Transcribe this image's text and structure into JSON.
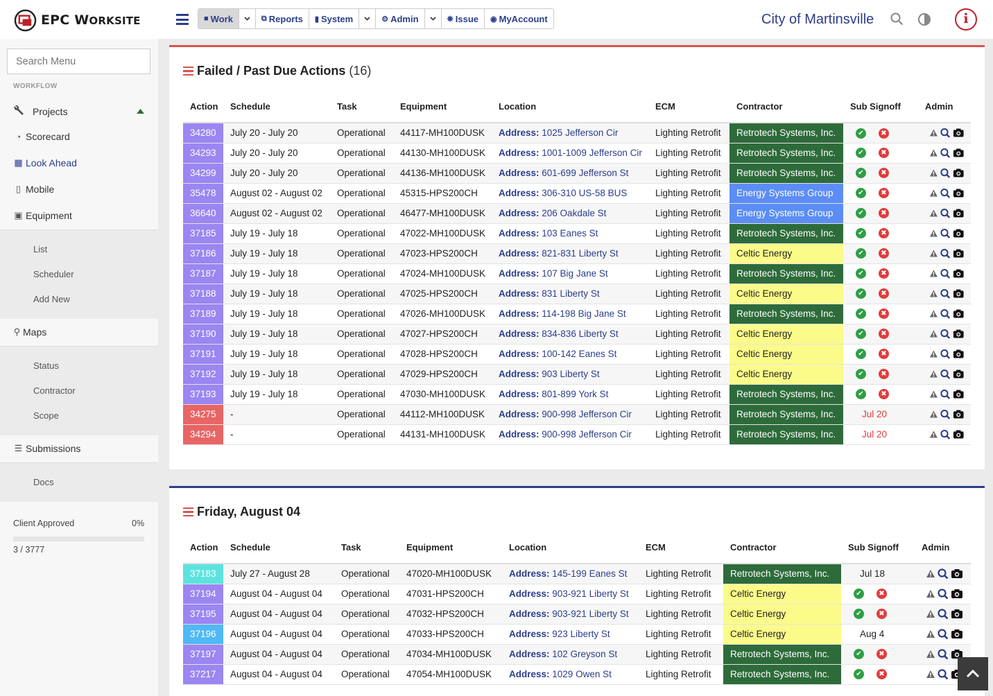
{
  "brand": {
    "logo_text": "EPC W",
    "logo_text_small": "ORKSITE"
  },
  "nav": [
    {
      "label": "Work",
      "icon": "folder-icon",
      "caret": true,
      "active": true
    },
    {
      "label": "Reports",
      "icon": "copy-icon",
      "caret": false
    },
    {
      "label": "System",
      "icon": "lock-icon",
      "caret": true
    },
    {
      "label": "Admin",
      "icon": "cogs-icon",
      "caret": true
    },
    {
      "label": "Issue",
      "icon": "bug-icon",
      "caret": false
    },
    {
      "label": "MyAccount",
      "icon": "user-circle-icon",
      "caret": false
    }
  ],
  "header": {
    "city": "City of Martinsville",
    "info_label": "i"
  },
  "sidebar": {
    "search_placeholder": "Search Menu",
    "section": "WORKFLOW",
    "items": {
      "projects": "Projects",
      "scorecard": "Scorecard",
      "lookahead": "Look Ahead",
      "mobile": "Mobile",
      "equipment": "Equipment",
      "maps": "Maps",
      "submissions": "Submissions"
    },
    "equipment_sub": [
      "List",
      "Scheduler",
      "Add New"
    ],
    "maps_sub": [
      "Status",
      "Contractor",
      "Scope"
    ],
    "submissions_sub": [
      "Docs"
    ],
    "progress": {
      "label": "Client Approved",
      "percent": "0%",
      "count": "3 / 3777",
      "fraction": 0
    }
  },
  "colors": {
    "purple": "#9b86f2",
    "red": "#e96565",
    "cyan": "#5de3df",
    "lightblue": "#4fb8f5",
    "green": "#2e6b3a",
    "blue": "#5b8df5",
    "yellow": "#fbfb8a",
    "navy": "#2c3e8a"
  },
  "panel1": {
    "title": "Failed / Past Due Actions",
    "count": "(16)",
    "columns": [
      "Action",
      "Schedule",
      "Task",
      "Equipment",
      "Location",
      "ECM",
      "Contractor",
      "Sub Signoff",
      "Admin"
    ],
    "address_label": "Address:",
    "rows": [
      {
        "id": "34280",
        "color": "purple",
        "schedule": "July 20 - July 20",
        "task": "Operational",
        "equipment": "44117-MH100DUSK",
        "address": "1025 Jefferson Cir",
        "ecm": "Lighting Retrofit",
        "contractor": "Retrotech Systems, Inc.",
        "ctype": "green",
        "signoff": ""
      },
      {
        "id": "34293",
        "color": "purple",
        "schedule": "July 20 - July 20",
        "task": "Operational",
        "equipment": "44130-MH100DUSK",
        "address": "1001-1009 Jefferson Cir",
        "ecm": "Lighting Retrofit",
        "contractor": "Retrotech Systems, Inc.",
        "ctype": "green",
        "signoff": ""
      },
      {
        "id": "34299",
        "color": "purple",
        "schedule": "July 20 - July 20",
        "task": "Operational",
        "equipment": "44136-MH100DUSK",
        "address": "601-699 Jefferson St",
        "ecm": "Lighting Retrofit",
        "contractor": "Retrotech Systems, Inc.",
        "ctype": "green",
        "signoff": ""
      },
      {
        "id": "35478",
        "color": "purple",
        "schedule": "August 02 - August 02",
        "task": "Operational",
        "equipment": "45315-HPS200CH",
        "address": "306-310 US-58 BUS",
        "ecm": "Lighting Retrofit",
        "contractor": "Energy Systems Group",
        "ctype": "blue",
        "signoff": ""
      },
      {
        "id": "36640",
        "color": "purple",
        "schedule": "August 02 - August 02",
        "task": "Operational",
        "equipment": "46477-MH100DUSK",
        "address": "206 Oakdale St",
        "ecm": "Lighting Retrofit",
        "contractor": "Energy Systems Group",
        "ctype": "blue",
        "signoff": ""
      },
      {
        "id": "37185",
        "color": "purple",
        "schedule": "July 19 - July 18",
        "task": "Operational",
        "equipment": "47022-MH100DUSK",
        "address": "103 Eanes St",
        "ecm": "Lighting Retrofit",
        "contractor": "Retrotech Systems, Inc.",
        "ctype": "green",
        "signoff": ""
      },
      {
        "id": "37186",
        "color": "purple",
        "schedule": "July 19 - July 18",
        "task": "Operational",
        "equipment": "47023-HPS200CH",
        "address": "821-831 Liberty St",
        "ecm": "Lighting Retrofit",
        "contractor": "Celtic Energy",
        "ctype": "yellow",
        "signoff": ""
      },
      {
        "id": "37187",
        "color": "purple",
        "schedule": "July 19 - July 18",
        "task": "Operational",
        "equipment": "47024-MH100DUSK",
        "address": "107 Big Jane St",
        "ecm": "Lighting Retrofit",
        "contractor": "Retrotech Systems, Inc.",
        "ctype": "green",
        "signoff": ""
      },
      {
        "id": "37188",
        "color": "purple",
        "schedule": "July 19 - July 18",
        "task": "Operational",
        "equipment": "47025-HPS200CH",
        "address": "831 Liberty St",
        "ecm": "Lighting Retrofit",
        "contractor": "Celtic Energy",
        "ctype": "yellow",
        "signoff": ""
      },
      {
        "id": "37189",
        "color": "purple",
        "schedule": "July 19 - July 18",
        "task": "Operational",
        "equipment": "47026-MH100DUSK",
        "address": "114-198 Big Jane St",
        "ecm": "Lighting Retrofit",
        "contractor": "Retrotech Systems, Inc.",
        "ctype": "green",
        "signoff": ""
      },
      {
        "id": "37190",
        "color": "purple",
        "schedule": "July 19 - July 18",
        "task": "Operational",
        "equipment": "47027-HPS200CH",
        "address": "834-836 Liberty St",
        "ecm": "Lighting Retrofit",
        "contractor": "Celtic Energy",
        "ctype": "yellow",
        "signoff": ""
      },
      {
        "id": "37191",
        "color": "purple",
        "schedule": "July 19 - July 18",
        "task": "Operational",
        "equipment": "47028-HPS200CH",
        "address": "100-142 Eanes St",
        "ecm": "Lighting Retrofit",
        "contractor": "Celtic Energy",
        "ctype": "yellow",
        "signoff": ""
      },
      {
        "id": "37192",
        "color": "purple",
        "schedule": "July 19 - July 18",
        "task": "Operational",
        "equipment": "47029-HPS200CH",
        "address": "903 Liberty St",
        "ecm": "Lighting Retrofit",
        "contractor": "Celtic Energy",
        "ctype": "yellow",
        "signoff": ""
      },
      {
        "id": "37193",
        "color": "purple",
        "schedule": "July 19 - July 18",
        "task": "Operational",
        "equipment": "47030-MH100DUSK",
        "address": "801-899 York St",
        "ecm": "Lighting Retrofit",
        "contractor": "Retrotech Systems, Inc.",
        "ctype": "green",
        "signoff": ""
      },
      {
        "id": "34275",
        "color": "red",
        "schedule": "-",
        "task": "Operational",
        "equipment": "44112-MH100DUSK",
        "address": "900-998 Jefferson Cir",
        "ecm": "Lighting Retrofit",
        "contractor": "Retrotech Systems, Inc.",
        "ctype": "green",
        "signoff": "Jul 20",
        "signoff_red": true
      },
      {
        "id": "34294",
        "color": "red",
        "schedule": "-",
        "task": "Operational",
        "equipment": "44131-MH100DUSK",
        "address": "900-998 Jefferson Cir",
        "ecm": "Lighting Retrofit",
        "contractor": "Retrotech Systems, Inc.",
        "ctype": "green",
        "signoff": "Jul 20",
        "signoff_red": true
      }
    ]
  },
  "panel2": {
    "title": "Friday, August 04",
    "columns": [
      "Action",
      "Schedule",
      "Task",
      "Equipment",
      "Location",
      "ECM",
      "Contractor",
      "Sub Signoff",
      "Admin"
    ],
    "address_label": "Address:",
    "rows": [
      {
        "id": "37183",
        "color": "cyan",
        "schedule": "July 27 - August 28",
        "task": "Operational",
        "equipment": "47020-MH100DUSK",
        "address": "145-199 Eanes St",
        "ecm": "Lighting Retrofit",
        "contractor": "Retrotech Systems, Inc.",
        "ctype": "green",
        "signoff": "Jul 18",
        "signoff_red": false
      },
      {
        "id": "37194",
        "color": "purple",
        "schedule": "August 04 - August 04",
        "task": "Operational",
        "equipment": "47031-HPS200CH",
        "address": "903-921 Liberty St",
        "ecm": "Lighting Retrofit",
        "contractor": "Celtic Energy",
        "ctype": "yellow",
        "signoff": ""
      },
      {
        "id": "37195",
        "color": "purple",
        "schedule": "August 04 - August 04",
        "task": "Operational",
        "equipment": "47032-HPS200CH",
        "address": "903-921 Liberty St",
        "ecm": "Lighting Retrofit",
        "contractor": "Celtic Energy",
        "ctype": "yellow",
        "signoff": ""
      },
      {
        "id": "37196",
        "color": "lightblue",
        "schedule": "August 04 - August 04",
        "task": "Operational",
        "equipment": "47033-HPS200CH",
        "address": "923 Liberty St",
        "ecm": "Lighting Retrofit",
        "contractor": "Celtic Energy",
        "ctype": "yellow",
        "signoff": "Aug 4",
        "signoff_red": false
      },
      {
        "id": "37197",
        "color": "purple",
        "schedule": "August 04 - August 04",
        "task": "Operational",
        "equipment": "47034-MH100DUSK",
        "address": "102 Greyson St",
        "ecm": "Lighting Retrofit",
        "contractor": "Retrotech Systems, Inc.",
        "ctype": "green",
        "signoff": ""
      },
      {
        "id": "37217",
        "color": "purple",
        "schedule": "August 04 - August 04",
        "task": "Operational",
        "equipment": "47054-MH100DUSK",
        "address": "1029 Owen St",
        "ecm": "Lighting Retrofit",
        "contractor": "Retrotech Systems, Inc.",
        "ctype": "green",
        "signoff": ""
      }
    ]
  }
}
